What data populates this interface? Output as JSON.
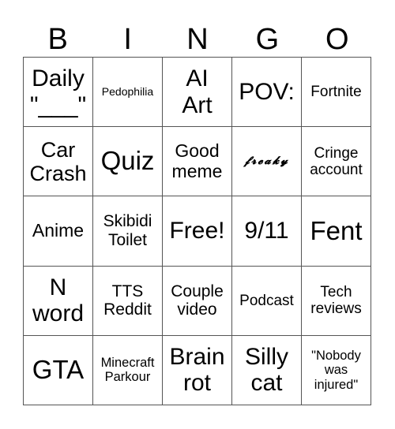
{
  "header": [
    "B",
    "I",
    "N",
    "G",
    "O"
  ],
  "cells": [
    [
      "Daily\n\"___\"",
      "Pedophilia",
      "AI\nArt",
      "POV:",
      "Fortnite"
    ],
    [
      "Car\nCrash",
      "Quiz",
      "Good\nmeme",
      "𝓯𝓻𝓮𝓪𝓴𝔂",
      "Cringe\naccount"
    ],
    [
      "Anime",
      "Skibidi\nToilet",
      "Free!",
      "9/11",
      "Fent"
    ],
    [
      "N\nword",
      "TTS\nReddit",
      "Couple\nvideo",
      "Podcast",
      "Tech\nreviews"
    ],
    [
      "GTA",
      "Minecraft\nParkour",
      "Brain\nrot",
      "Silly\ncat",
      "\"Nobody\nwas\ninjured\""
    ]
  ]
}
